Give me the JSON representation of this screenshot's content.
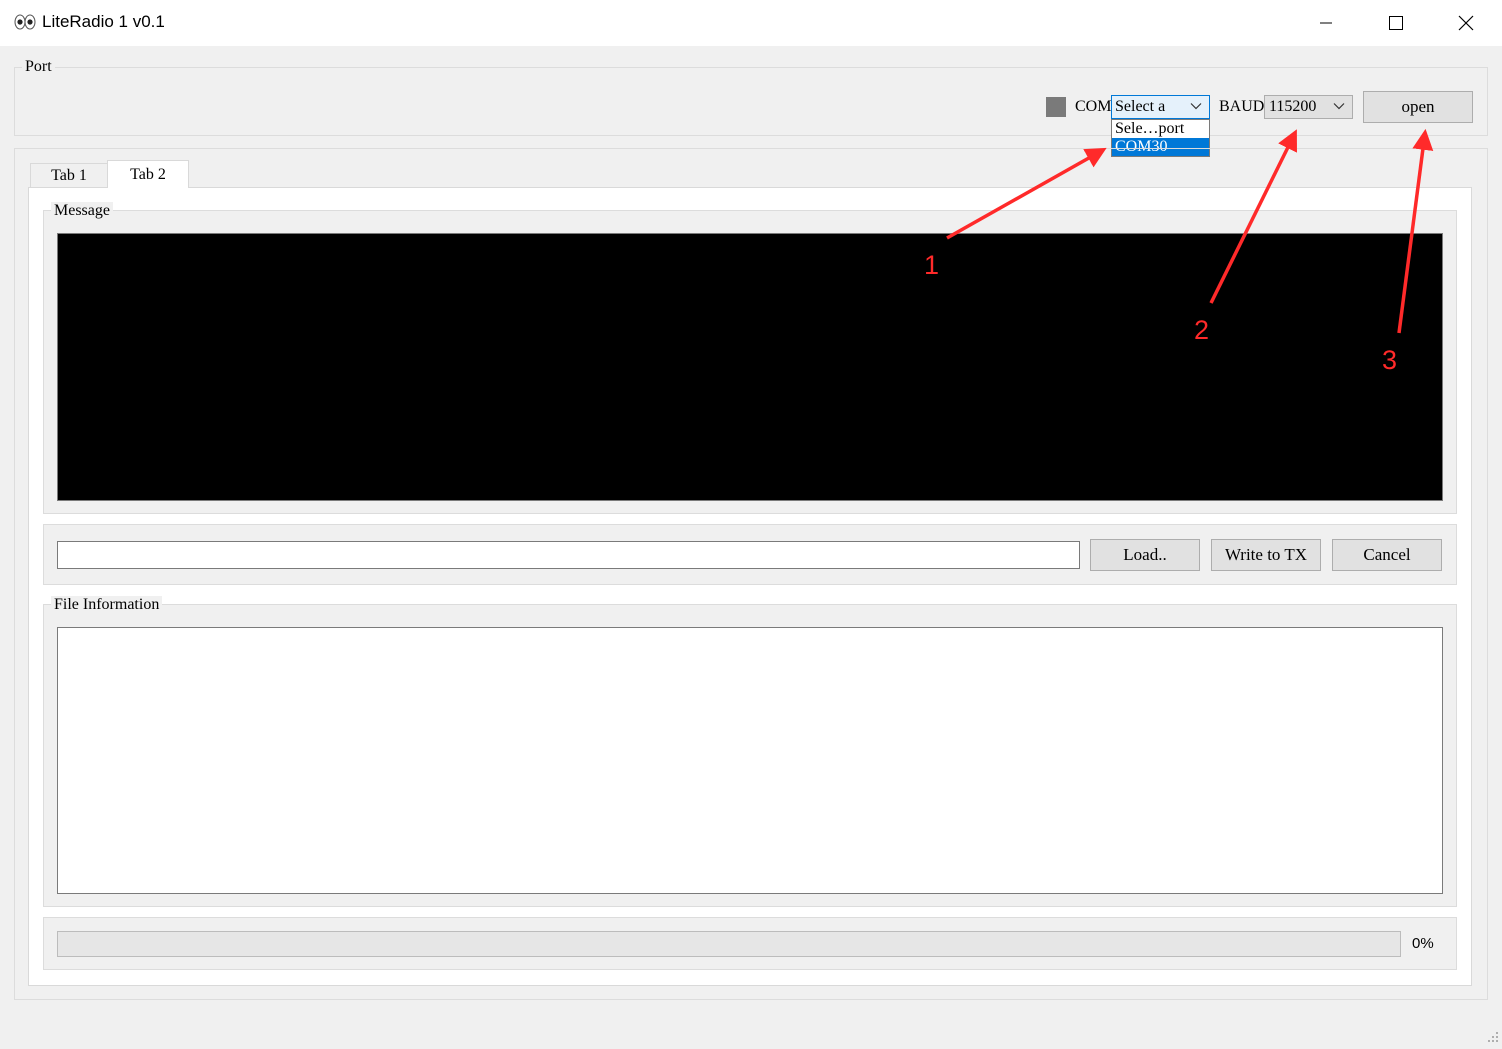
{
  "window": {
    "title": "LiteRadio 1 v0.1",
    "controls": [
      "minimize-icon",
      "maximize-icon",
      "close-icon"
    ]
  },
  "port": {
    "group_title": "Port",
    "com_label": "COM",
    "com_selected": "Select a",
    "com_options": [
      "Sele…port",
      "COM30"
    ],
    "com_highlighted": "COM30",
    "baud_label": "BAUD",
    "baud_selected": "115200",
    "open_label": "open",
    "status_color": "#7a7a7a"
  },
  "tabs": [
    {
      "label": "Tab 1"
    },
    {
      "label": "Tab 2",
      "active": true
    }
  ],
  "message": {
    "group_title": "Message"
  },
  "file": {
    "path_value": "",
    "load_label": "Load..",
    "write_label": "Write to TX",
    "cancel_label": "Cancel"
  },
  "file_info": {
    "group_title": "File Information"
  },
  "progress": {
    "value_percent": 0,
    "label": "0%"
  },
  "annotations": {
    "color": "#ff2a2a",
    "labels": [
      "1",
      "2",
      "3"
    ]
  }
}
